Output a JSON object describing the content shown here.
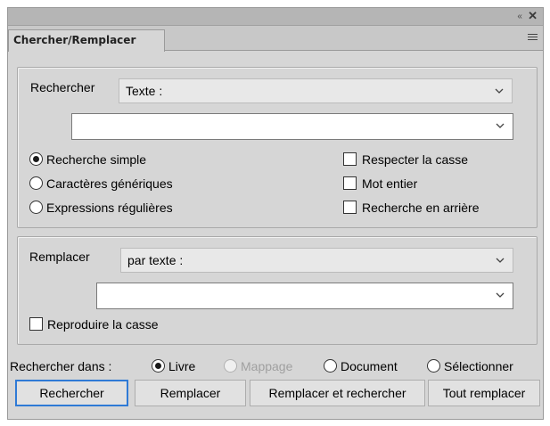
{
  "window": {
    "tab_title": "Chercher/Remplacer",
    "collapse_icon": "double-chevron-left-icon",
    "close_icon": "close-icon",
    "menu_icon": "panel-menu-icon"
  },
  "search": {
    "label": "Rechercher",
    "type_select": "Texte :",
    "query_value": "",
    "modes": [
      {
        "label": "Recherche simple",
        "selected": true
      },
      {
        "label": "Caractères génériques",
        "selected": false
      },
      {
        "label": "Expressions régulières",
        "selected": false
      }
    ],
    "options": [
      {
        "label": "Respecter la casse",
        "checked": false
      },
      {
        "label": "Mot entier",
        "checked": false
      },
      {
        "label": "Recherche en arrière",
        "checked": false
      }
    ]
  },
  "replace": {
    "label": "Remplacer",
    "type_select": "par texte :",
    "value": "",
    "preserve_case": {
      "label": "Reproduire la casse",
      "checked": false
    }
  },
  "scope": {
    "label": "Rechercher dans :",
    "options": [
      {
        "label": "Livre",
        "selected": true,
        "enabled": true
      },
      {
        "label": "Mappage",
        "selected": false,
        "enabled": false
      },
      {
        "label": "Document",
        "selected": false,
        "enabled": true
      },
      {
        "label": "Sélectionner",
        "selected": false,
        "enabled": true
      }
    ]
  },
  "buttons": {
    "find": "Rechercher",
    "replace": "Remplacer",
    "replace_find": "Remplacer et rechercher",
    "replace_all": "Tout remplacer"
  },
  "colors": {
    "panel_bg": "#d6d6d6",
    "default_button_border": "#2f7ad6"
  }
}
